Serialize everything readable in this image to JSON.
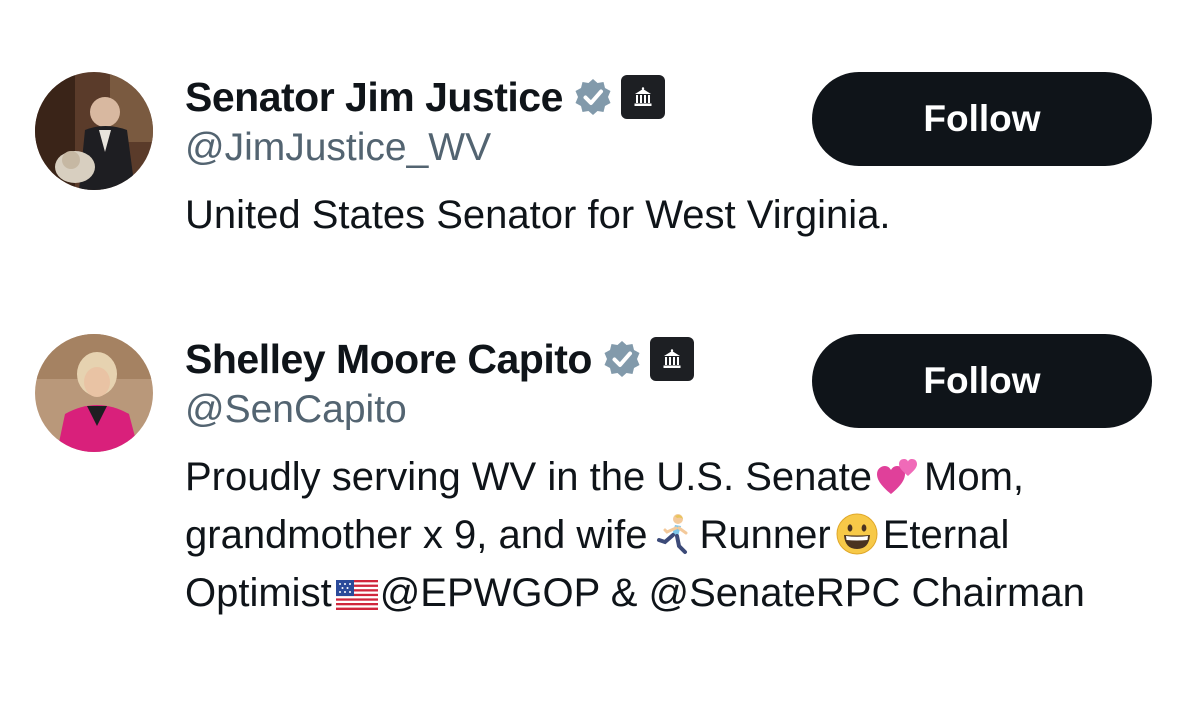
{
  "users": [
    {
      "display_name": "Senator Jim Justice",
      "handle": "@JimJustice_WV",
      "bio": "United States Senator for West Virginia.",
      "follow_label": "Follow",
      "verified_badge": "verified-checkmark-icon",
      "affiliate_badge": "government-building-icon"
    },
    {
      "display_name": "Shelley Moore Capito",
      "handle": "@SenCapito",
      "bio_parts": {
        "p1": "Proudly serving WV in the U.S. Senate",
        "e1": "two-hearts-emoji",
        "p2": "Mom, grandmother x 9, and wife",
        "e2": "woman-running-emoji",
        "p3": "Runner",
        "e3": "grinning-face-emoji",
        "p4": "Eternal Optimist",
        "e4": "us-flag-emoji",
        "p5": "@EPWGOP & @SenateRPC Chairman"
      },
      "follow_label": "Follow",
      "verified_badge": "verified-checkmark-icon",
      "affiliate_badge": "government-building-icon"
    }
  ],
  "colors": {
    "text_primary": "#0f1419",
    "text_secondary": "#536471",
    "follow_button_bg": "#0f1419",
    "follow_button_text": "#ffffff",
    "verified_badge": "#829aab",
    "gov_badge_bg": "#1d1f23"
  }
}
